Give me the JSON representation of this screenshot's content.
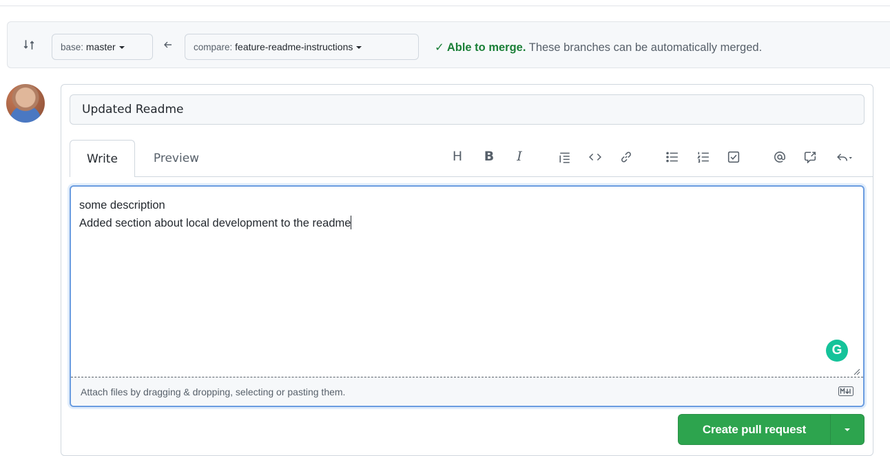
{
  "compare": {
    "base_prefix": "base:",
    "base_branch": "master",
    "compare_prefix": "compare:",
    "compare_branch": "feature-readme-instructions",
    "merge_ok": "Able to merge.",
    "merge_detail": "These branches can be automatically merged."
  },
  "pr": {
    "title": "Updated Readme",
    "tabs": [
      "Write",
      "Preview"
    ],
    "body_lines": [
      "some description",
      "Added section about local development to the readme"
    ],
    "attach_hint": "Attach files by dragging & dropping, selecting or pasting them.",
    "grammarly_letter": "G"
  },
  "toolbar": {
    "heading": "H",
    "bold": "B",
    "italic": "I",
    "icons": [
      "heading-icon",
      "bold-icon",
      "italic-icon",
      "quote-icon",
      "code-icon",
      "link-icon",
      "bulleted-list-icon",
      "numbered-list-icon",
      "task-list-icon",
      "mention-icon",
      "reference-icon",
      "reply-icon"
    ]
  },
  "actions": {
    "create_label": "Create pull request"
  },
  "colors": {
    "primary_green": "#2da44e",
    "merge_green": "#1a7f37",
    "focus_blue": "#6a9ce0"
  }
}
